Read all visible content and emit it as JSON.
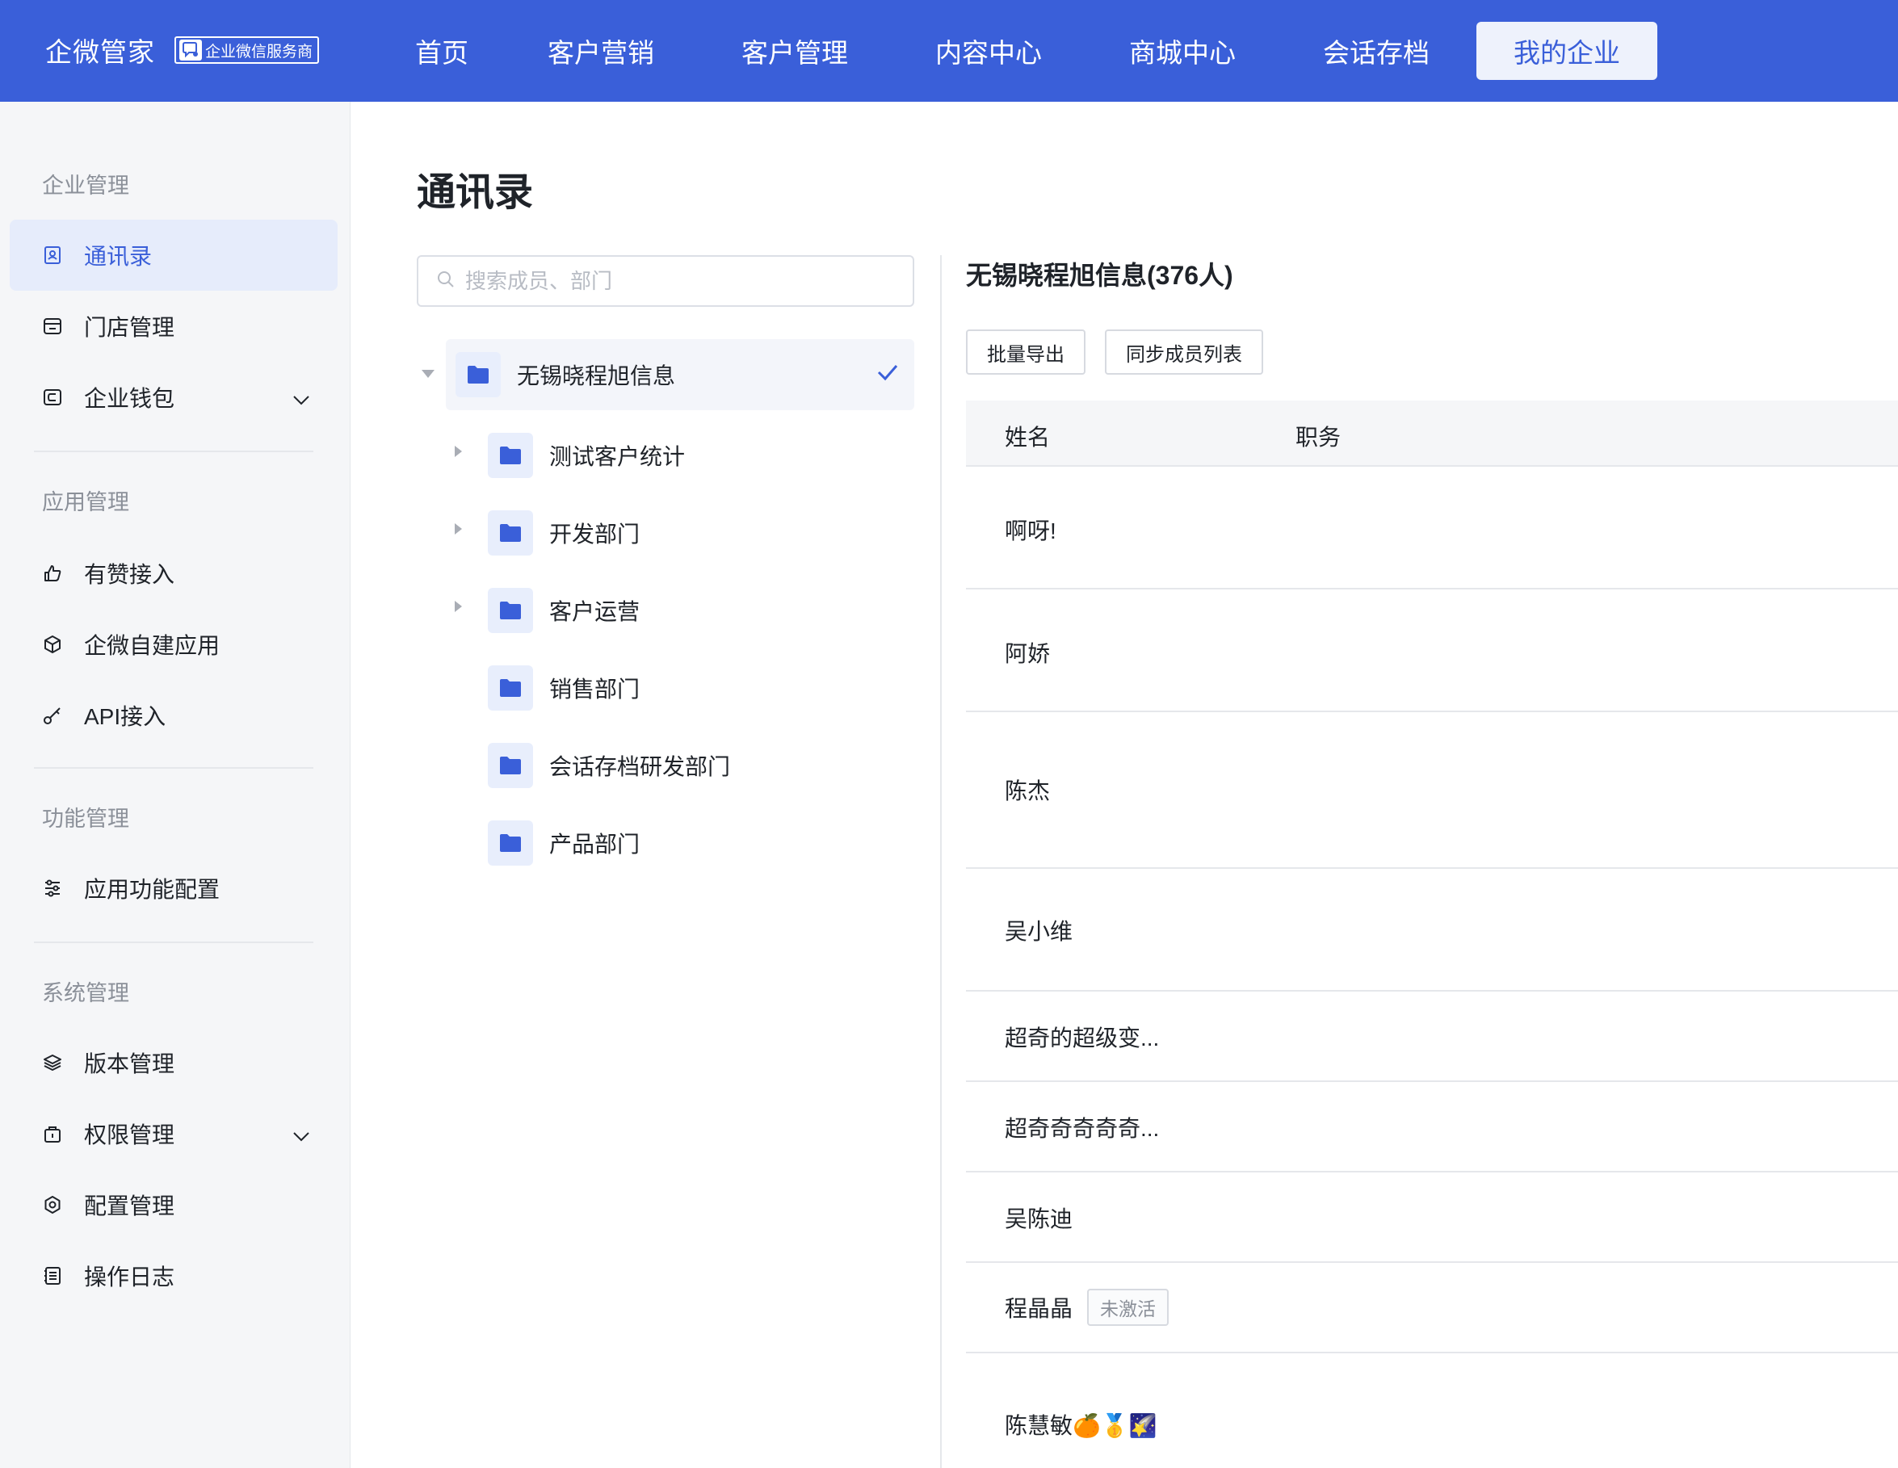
{
  "brand": {
    "name": "企微管家",
    "badge": "企业微信服务商"
  },
  "nav": {
    "items": [
      {
        "label": "首页"
      },
      {
        "label": "客户营销"
      },
      {
        "label": "客户管理"
      },
      {
        "label": "内容中心"
      },
      {
        "label": "商城中心"
      },
      {
        "label": "会话存档"
      },
      {
        "label": "我的企业",
        "active": true
      }
    ]
  },
  "sidebar": {
    "groups": [
      {
        "title": "企业管理",
        "items": [
          {
            "label": "通讯录",
            "icon": "contacts-icon",
            "active": true
          },
          {
            "label": "门店管理",
            "icon": "store-icon"
          },
          {
            "label": "企业钱包",
            "icon": "wallet-icon",
            "expandable": true
          }
        ]
      },
      {
        "title": "应用管理",
        "items": [
          {
            "label": "有赞接入",
            "icon": "thumbs-up-icon"
          },
          {
            "label": "企微自建应用",
            "icon": "cube-icon"
          },
          {
            "label": "API接入",
            "icon": "key-icon"
          }
        ]
      },
      {
        "title": "功能管理",
        "items": [
          {
            "label": "应用功能配置",
            "icon": "sliders-icon"
          }
        ]
      },
      {
        "title": "系统管理",
        "items": [
          {
            "label": "版本管理",
            "icon": "layers-icon"
          },
          {
            "label": "权限管理",
            "icon": "lock-icon",
            "expandable": true
          },
          {
            "label": "配置管理",
            "icon": "settings-icon"
          },
          {
            "label": "操作日志",
            "icon": "log-icon"
          }
        ]
      }
    ]
  },
  "main": {
    "title": "通讯录",
    "search": {
      "placeholder": "搜索成员、部门",
      "value": ""
    },
    "tree": {
      "root": {
        "label": "无锡晓程旭信息",
        "selected": true,
        "expanded": true
      },
      "children": [
        {
          "label": "测试客户统计",
          "has_children": true
        },
        {
          "label": "开发部门",
          "has_children": true
        },
        {
          "label": "客户运营",
          "has_children": true
        },
        {
          "label": "销售部门",
          "has_children": false
        },
        {
          "label": "会话存档研发部门",
          "has_children": false
        },
        {
          "label": "产品部门",
          "has_children": false
        }
      ]
    },
    "department": {
      "title": "无锡晓程旭信息(376人)",
      "buttons": {
        "export": "批量导出",
        "sync": "同步成员列表"
      },
      "columns": {
        "name": "姓名",
        "position": "职务"
      },
      "members": [
        {
          "name": "啊呀!"
        },
        {
          "name": "阿娇"
        },
        {
          "name": "陈杰"
        },
        {
          "name": "吴小维"
        },
        {
          "name": "超奇的超级变..."
        },
        {
          "name": "超奇奇奇奇奇..."
        },
        {
          "name": "吴陈迪"
        },
        {
          "name": "程晶晶",
          "tag": "未激活"
        },
        {
          "name": "陈慧敏🍊🥇🌠"
        }
      ]
    }
  },
  "colors": {
    "primary": "#3a5fd9",
    "sidebar_bg": "#f5f6f8",
    "active_bg": "#e6ecfb"
  }
}
